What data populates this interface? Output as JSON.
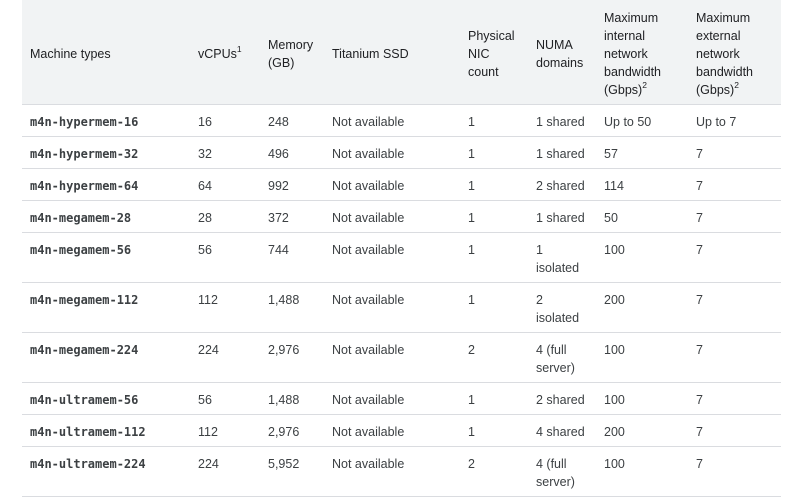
{
  "headers": {
    "machine_types": "Machine types",
    "vcpus": "vCPUs",
    "vcpus_note": "1",
    "memory": "Memory (GB)",
    "titanium_ssd": "Titanium SSD",
    "physical_nic": "Physical NIC count",
    "numa": "NUMA domains",
    "max_internal": "Maximum internal network bandwidth (Gbps)",
    "max_internal_note": "2",
    "max_external": "Maximum external network bandwidth (Gbps)",
    "max_external_note": "2"
  },
  "rows": [
    {
      "machine": "m4n-hypermem-16",
      "vcpus": "16",
      "memory": "248",
      "ssd": "Not available",
      "nic": "1",
      "numa": "1 shared",
      "internal": "Up to 50",
      "external": "Up to 7"
    },
    {
      "machine": "m4n-hypermem-32",
      "vcpus": "32",
      "memory": "496",
      "ssd": "Not available",
      "nic": "1",
      "numa": "1 shared",
      "internal": "57",
      "external": "7"
    },
    {
      "machine": "m4n-hypermem-64",
      "vcpus": "64",
      "memory": "992",
      "ssd": "Not available",
      "nic": "1",
      "numa": "2 shared",
      "internal": "114",
      "external": "7"
    },
    {
      "machine": "m4n-megamem-28",
      "vcpus": "28",
      "memory": "372",
      "ssd": "Not available",
      "nic": "1",
      "numa": "1 shared",
      "internal": "50",
      "external": "7"
    },
    {
      "machine": "m4n-megamem-56",
      "vcpus": "56",
      "memory": "744",
      "ssd": "Not available",
      "nic": "1",
      "numa": "1 isolated",
      "internal": "100",
      "external": "7"
    },
    {
      "machine": "m4n-megamem-112",
      "vcpus": "112",
      "memory": "1,488",
      "ssd": "Not available",
      "nic": "1",
      "numa": "2 isolated",
      "internal": "200",
      "external": "7"
    },
    {
      "machine": "m4n-megamem-224",
      "vcpus": "224",
      "memory": "2,976",
      "ssd": "Not available",
      "nic": "2",
      "numa": "4 (full server)",
      "internal": "100",
      "external": "7"
    },
    {
      "machine": "m4n-ultramem-56",
      "vcpus": "56",
      "memory": "1,488",
      "ssd": "Not available",
      "nic": "1",
      "numa": "2 shared",
      "internal": "100",
      "external": "7"
    },
    {
      "machine": "m4n-ultramem-112",
      "vcpus": "112",
      "memory": "2,976",
      "ssd": "Not available",
      "nic": "1",
      "numa": "4 shared",
      "internal": "200",
      "external": "7"
    },
    {
      "machine": "m4n-ultramem-224",
      "vcpus": "224",
      "memory": "5,952",
      "ssd": "Not available",
      "nic": "2",
      "numa": "4 (full server)",
      "internal": "100",
      "external": "7"
    }
  ]
}
